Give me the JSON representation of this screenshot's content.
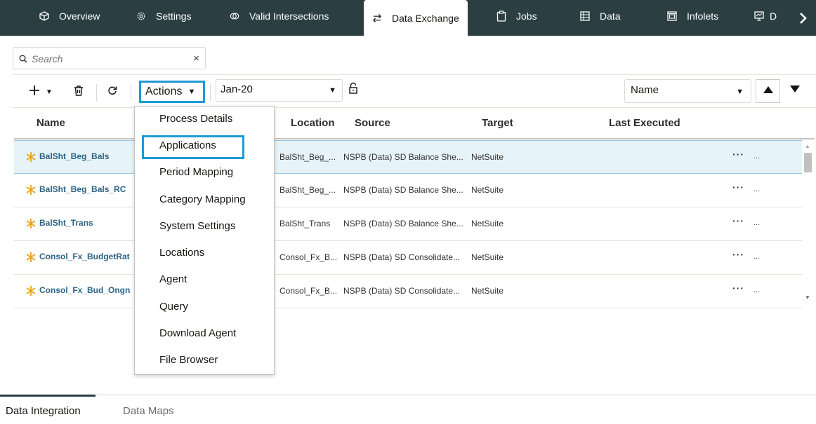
{
  "topnav": {
    "tabs": [
      {
        "label": "Overview",
        "icon": "cube-icon"
      },
      {
        "label": "Settings",
        "icon": "gear-icon"
      },
      {
        "label": "Valid Intersections",
        "icon": "intersect-icon"
      },
      {
        "label": "Data Exchange",
        "icon": "exchange-icon",
        "active": true
      },
      {
        "label": "Jobs",
        "icon": "clipboard-icon"
      },
      {
        "label": "Data",
        "icon": "grid-icon"
      },
      {
        "label": "Infolets",
        "icon": "infolet-icon"
      },
      {
        "label": "D",
        "icon": "dashboard-icon"
      }
    ],
    "more_icon": "chevron-right-icon",
    "color": "#2b3f42"
  },
  "search": {
    "placeholder": "Search",
    "clear_icon": "close-icon"
  },
  "toolbar": {
    "add_icon": "plus-icon",
    "delete_icon": "trash-icon",
    "refresh_icon": "refresh-icon",
    "actions_label": "Actions",
    "period_value": "Jan-20",
    "lock_icon": "unlock-icon",
    "sort_field": "Name",
    "sort_up_icon": "triangle-up-icon",
    "sort_down_icon": "triangle-down-icon",
    "highlight_color": "#1e9ad6"
  },
  "table": {
    "columns": [
      "Name",
      "Location",
      "Source",
      "Target",
      "Last Executed"
    ],
    "rows": [
      {
        "name": "BalSht_Beg_Bals",
        "location": "BalSht_Beg_...",
        "source": "NSPB (Data) SD Balance She...",
        "target": "NetSuite",
        "more": "···",
        "extra": "..."
      },
      {
        "name": "BalSht_Beg_Bals_RC",
        "location": "BalSht_Beg_...",
        "source": "NSPB (Data) SD Balance She...",
        "target": "NetSuite",
        "more": "···",
        "extra": "..."
      },
      {
        "name": "BalSht_Trans",
        "location": "BalSht_Trans",
        "source": "NSPB (Data) SD Balance She...",
        "target": "NetSuite",
        "more": "···",
        "extra": "..."
      },
      {
        "name": "Consol_Fx_BudgetRat",
        "location": "Consol_Fx_B...",
        "source": "NSPB (Data) SD Consolidate...",
        "target": "NetSuite",
        "more": "···",
        "extra": "..."
      },
      {
        "name": "Consol_Fx_Bud_Ongn",
        "location": "Consol_Fx_B...",
        "source": "NSPB (Data) SD Consolidate...",
        "target": "NetSuite",
        "more": "···",
        "extra": "..."
      }
    ]
  },
  "actions_menu": {
    "items": [
      "Process Details",
      "Applications",
      "Period Mapping",
      "Category Mapping",
      "System Settings",
      "Locations",
      "Agent",
      "Query",
      "Download Agent",
      "File Browser"
    ],
    "highlighted": "Applications"
  },
  "bottom_tabs": [
    {
      "label": "Data Integration",
      "active": true
    },
    {
      "label": "Data Maps"
    }
  ]
}
